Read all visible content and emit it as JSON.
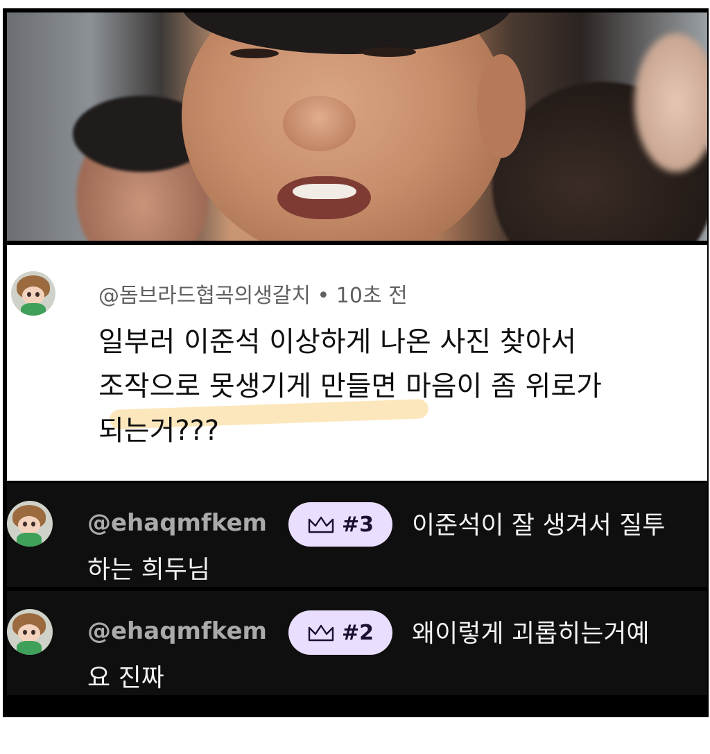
{
  "comment": {
    "author": "@돔브라드협곡의생갈치",
    "time": "10초 전",
    "separator": "•",
    "line1": "일부러 이준석 이상하게 나온 사진 찾아서",
    "line2": "조작으로 못생기게 만들면 마음이 좀 위로가",
    "line3": "되는거???"
  },
  "replies": [
    {
      "author": "@ehaqmfkem",
      "rank": "#3",
      "text_line1": "이준석이 잘 생겨서 질투",
      "text_line2": "하는 희두님"
    },
    {
      "author": "@ehaqmfkem",
      "rank": "#2",
      "text_line1": "왜이렇게 괴롭히는거예",
      "text_line2": "요 진짜"
    }
  ],
  "icons": {
    "badge": "crown-icon",
    "avatar": "doll-avatar-icon"
  },
  "colors": {
    "badge_bg": "#e9defd",
    "highlight": "#fbe3b0",
    "dark_bg": "#0f0f0f"
  }
}
